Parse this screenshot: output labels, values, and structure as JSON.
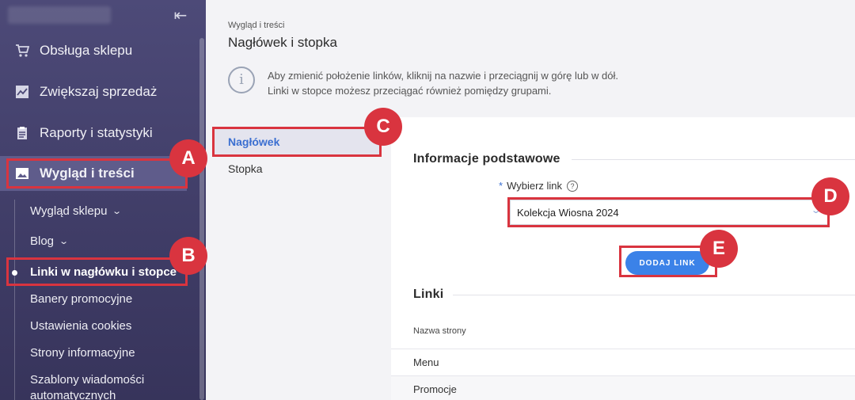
{
  "sidebar": {
    "items": [
      {
        "label": "Obsługa sklepu",
        "icon": "cart-icon"
      },
      {
        "label": "Zwiększaj sprzedaż",
        "icon": "chart-icon"
      },
      {
        "label": "Raporty i statystyki",
        "icon": "clipboard-icon"
      },
      {
        "label": "Wygląd i treści",
        "icon": "image-icon",
        "active": true
      }
    ],
    "subitems": [
      {
        "label": "Wygląd sklepu",
        "chevron": true
      },
      {
        "label": "Blog",
        "chevron": true
      },
      {
        "label": "Linki w nagłówku i stopce",
        "active": true
      },
      {
        "label": "Banery promocyjne"
      },
      {
        "label": "Ustawienia cookies"
      },
      {
        "label": "Strony informacyjne"
      },
      {
        "label": "Szablony wiadomości"
      },
      {
        "label": "automatycznych"
      }
    ]
  },
  "breadcrumb": "Wygląd i treści",
  "page_title": "Nagłówek i stopka",
  "info": {
    "line1": "Aby zmienić położenie linków, kliknij na nazwie i przeciągnij w górę lub w dół.",
    "line2": "Linki w stopce możesz przeciągać również pomiędzy grupami."
  },
  "tabs": [
    {
      "label": "Nagłówek",
      "active": true
    },
    {
      "label": "Stopka"
    }
  ],
  "form": {
    "section_title": "Informacje podstawowe",
    "required_mark": "*",
    "select_label": "Wybierz link",
    "help_glyph": "?",
    "select_value": "Kolekcja Wiosna 2024",
    "add_button": "DODAJ LINK"
  },
  "links": {
    "section_title": "Linki",
    "column_header": "Nazwa strony",
    "rows": [
      "Menu",
      "Promocje"
    ]
  },
  "annotations": [
    "A",
    "B",
    "C",
    "D",
    "E"
  ],
  "colors": {
    "sidebar_bg": "#4d4a78",
    "accent_blue": "#3b82e8",
    "highlight_red": "#d9343f",
    "active_tab_text": "#3b6fd1"
  }
}
